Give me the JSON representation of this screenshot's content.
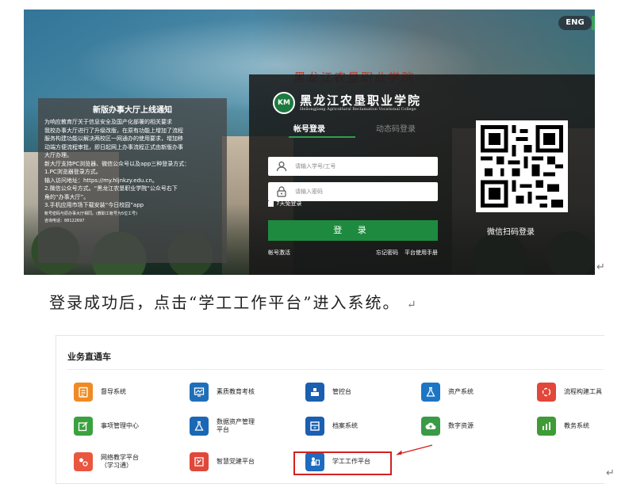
{
  "login_screenshot": {
    "lang_button": "ENG",
    "banner_slogan": "黑龙江农垦职业学院",
    "notice": {
      "title": "新版办事大厅上线通知",
      "lines": [
        "为响应教育厅关于信息安全及国产化部署的相关要求",
        "我校办事大厅进行了升级改版，在原有功能上增加了流程",
        "服务构建功能以解决两校区一网通办的使用要求，增加移",
        "动端方便流程审批，即日起网上办事流程正式由新版办事",
        "大厅办理。",
        "新大厅支持PC浏览器、微信公众号以及app三种登录方式：",
        "1.PC浏览器登录方式。",
        "  输入访问地址：https://my.hljnkzy.edu.cn。",
        "2.微信公众号方式。“黑龙江农垦职业学院”公众号右下",
        "  角的“办事大厅”。",
        "3.手机应用市场下载安装“今日校园”app"
      ],
      "footnote_1": "帐号密码与原办事大厅相同。(教职工帐号为5位工号)",
      "footnote_2": "咨询电话：88122697"
    },
    "school": {
      "logo_text": "KM",
      "name_cn": "黑龙江农垦职业学院",
      "name_en": "Heilongjiang Agricultural Reclamation Vocational College"
    },
    "tabs": {
      "account_login": "帐号登录",
      "sms_login": "动态码登录"
    },
    "username_placeholder": "请输入学号/工号",
    "password_placeholder": "请输入密码",
    "remember_label": "7天免登录",
    "login_button": "登 录",
    "activate_link": "帐号激活",
    "forgot_link": "忘记密码",
    "manual_link": "平台使用手册",
    "qr_label": "微信扫码登录"
  },
  "instruction": "登录成功后，点击“学工工作平台”进入系统。",
  "return_mark": "↵",
  "portal_screenshot": {
    "section_title": "业务直通车",
    "apps": [
      {
        "label": "督导系统",
        "color": "#f08a24",
        "glyph": "督"
      },
      {
        "label": "素质教育考核",
        "color": "#1f6fb8",
        "glyph": "素"
      },
      {
        "label": "管控台",
        "color": "#1a5fb0",
        "glyph": "管"
      },
      {
        "label": "资产系统",
        "color": "#1d75c4",
        "glyph": "资"
      },
      {
        "label": "流程构建工具",
        "color": "#e2473a",
        "glyph": "流"
      },
      {
        "label": "事项管理中心",
        "color": "#3aa13f",
        "glyph": "事"
      },
      {
        "label": "数据资产管理\n平台",
        "color": "#1a68b5",
        "glyph": "数"
      },
      {
        "label": "档案系统",
        "color": "#1a5fb0",
        "glyph": "档"
      },
      {
        "label": "数字资源",
        "color": "#3a9a46",
        "glyph": "云"
      },
      {
        "label": "教务系统",
        "color": "#3e9b36",
        "glyph": "教"
      },
      {
        "label": "网络教学平台\n（学习通）",
        "color": "#e9573f",
        "glyph": "网"
      },
      {
        "label": "智慧党建平台",
        "color": "#e0483a",
        "glyph": "党"
      },
      {
        "label": "学工工作平台",
        "color": "#1e6bbf",
        "glyph": "学"
      }
    ]
  }
}
